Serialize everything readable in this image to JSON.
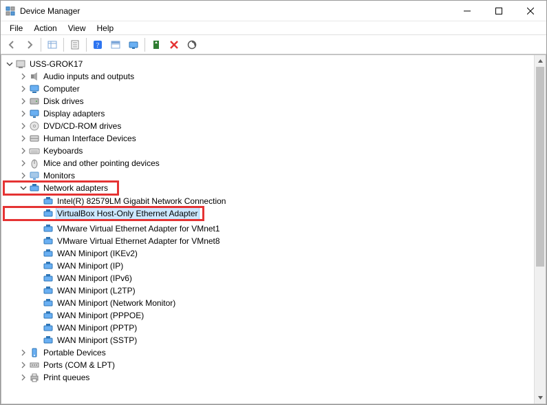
{
  "window": {
    "title": "Device Manager"
  },
  "menu": {
    "file": "File",
    "action": "Action",
    "view": "View",
    "help": "Help"
  },
  "toolbar_icons": {
    "back": "back-arrow-icon",
    "forward": "forward-arrow-icon",
    "show_hidden": "show-hidden-icon",
    "properties": "properties-icon",
    "help": "help-icon",
    "action_view": "action-view-icon",
    "update": "update-driver-icon",
    "uninstall": "uninstall-icon",
    "disable": "disable-icon",
    "scan": "scan-hardware-icon"
  },
  "tree": {
    "root": "USS-GROK17",
    "categories": [
      {
        "label": "Audio inputs and outputs",
        "icon": "audio",
        "expanded": false
      },
      {
        "label": "Computer",
        "icon": "computer",
        "expanded": false
      },
      {
        "label": "Disk drives",
        "icon": "disk",
        "expanded": false
      },
      {
        "label": "Display adapters",
        "icon": "display",
        "expanded": false
      },
      {
        "label": "DVD/CD-ROM drives",
        "icon": "dvd",
        "expanded": false
      },
      {
        "label": "Human Interface Devices",
        "icon": "hid",
        "expanded": false
      },
      {
        "label": "Keyboards",
        "icon": "keyboard",
        "expanded": false
      },
      {
        "label": "Mice and other pointing devices",
        "icon": "mouse",
        "expanded": false
      },
      {
        "label": "Monitors",
        "icon": "monitor",
        "expanded": false
      },
      {
        "label": "Network adapters",
        "icon": "network",
        "expanded": true,
        "highlighted": true,
        "children": [
          {
            "label": "Intel(R) 82579LM Gigabit Network Connection",
            "selected": false
          },
          {
            "label": "VirtualBox Host-Only Ethernet Adapter",
            "selected": true,
            "highlighted": true
          },
          {
            "label": "VMware Virtual Ethernet Adapter for VMnet1",
            "selected": false
          },
          {
            "label": "VMware Virtual Ethernet Adapter for VMnet8",
            "selected": false
          },
          {
            "label": "WAN Miniport (IKEv2)",
            "selected": false
          },
          {
            "label": "WAN Miniport (IP)",
            "selected": false
          },
          {
            "label": "WAN Miniport (IPv6)",
            "selected": false
          },
          {
            "label": "WAN Miniport (L2TP)",
            "selected": false
          },
          {
            "label": "WAN Miniport (Network Monitor)",
            "selected": false
          },
          {
            "label": "WAN Miniport (PPPOE)",
            "selected": false
          },
          {
            "label": "WAN Miniport (PPTP)",
            "selected": false
          },
          {
            "label": "WAN Miniport (SSTP)",
            "selected": false
          }
        ]
      },
      {
        "label": "Portable Devices",
        "icon": "portable",
        "expanded": false
      },
      {
        "label": "Ports (COM & LPT)",
        "icon": "ports",
        "expanded": false
      },
      {
        "label": "Print queues",
        "icon": "print",
        "expanded": false
      }
    ]
  }
}
